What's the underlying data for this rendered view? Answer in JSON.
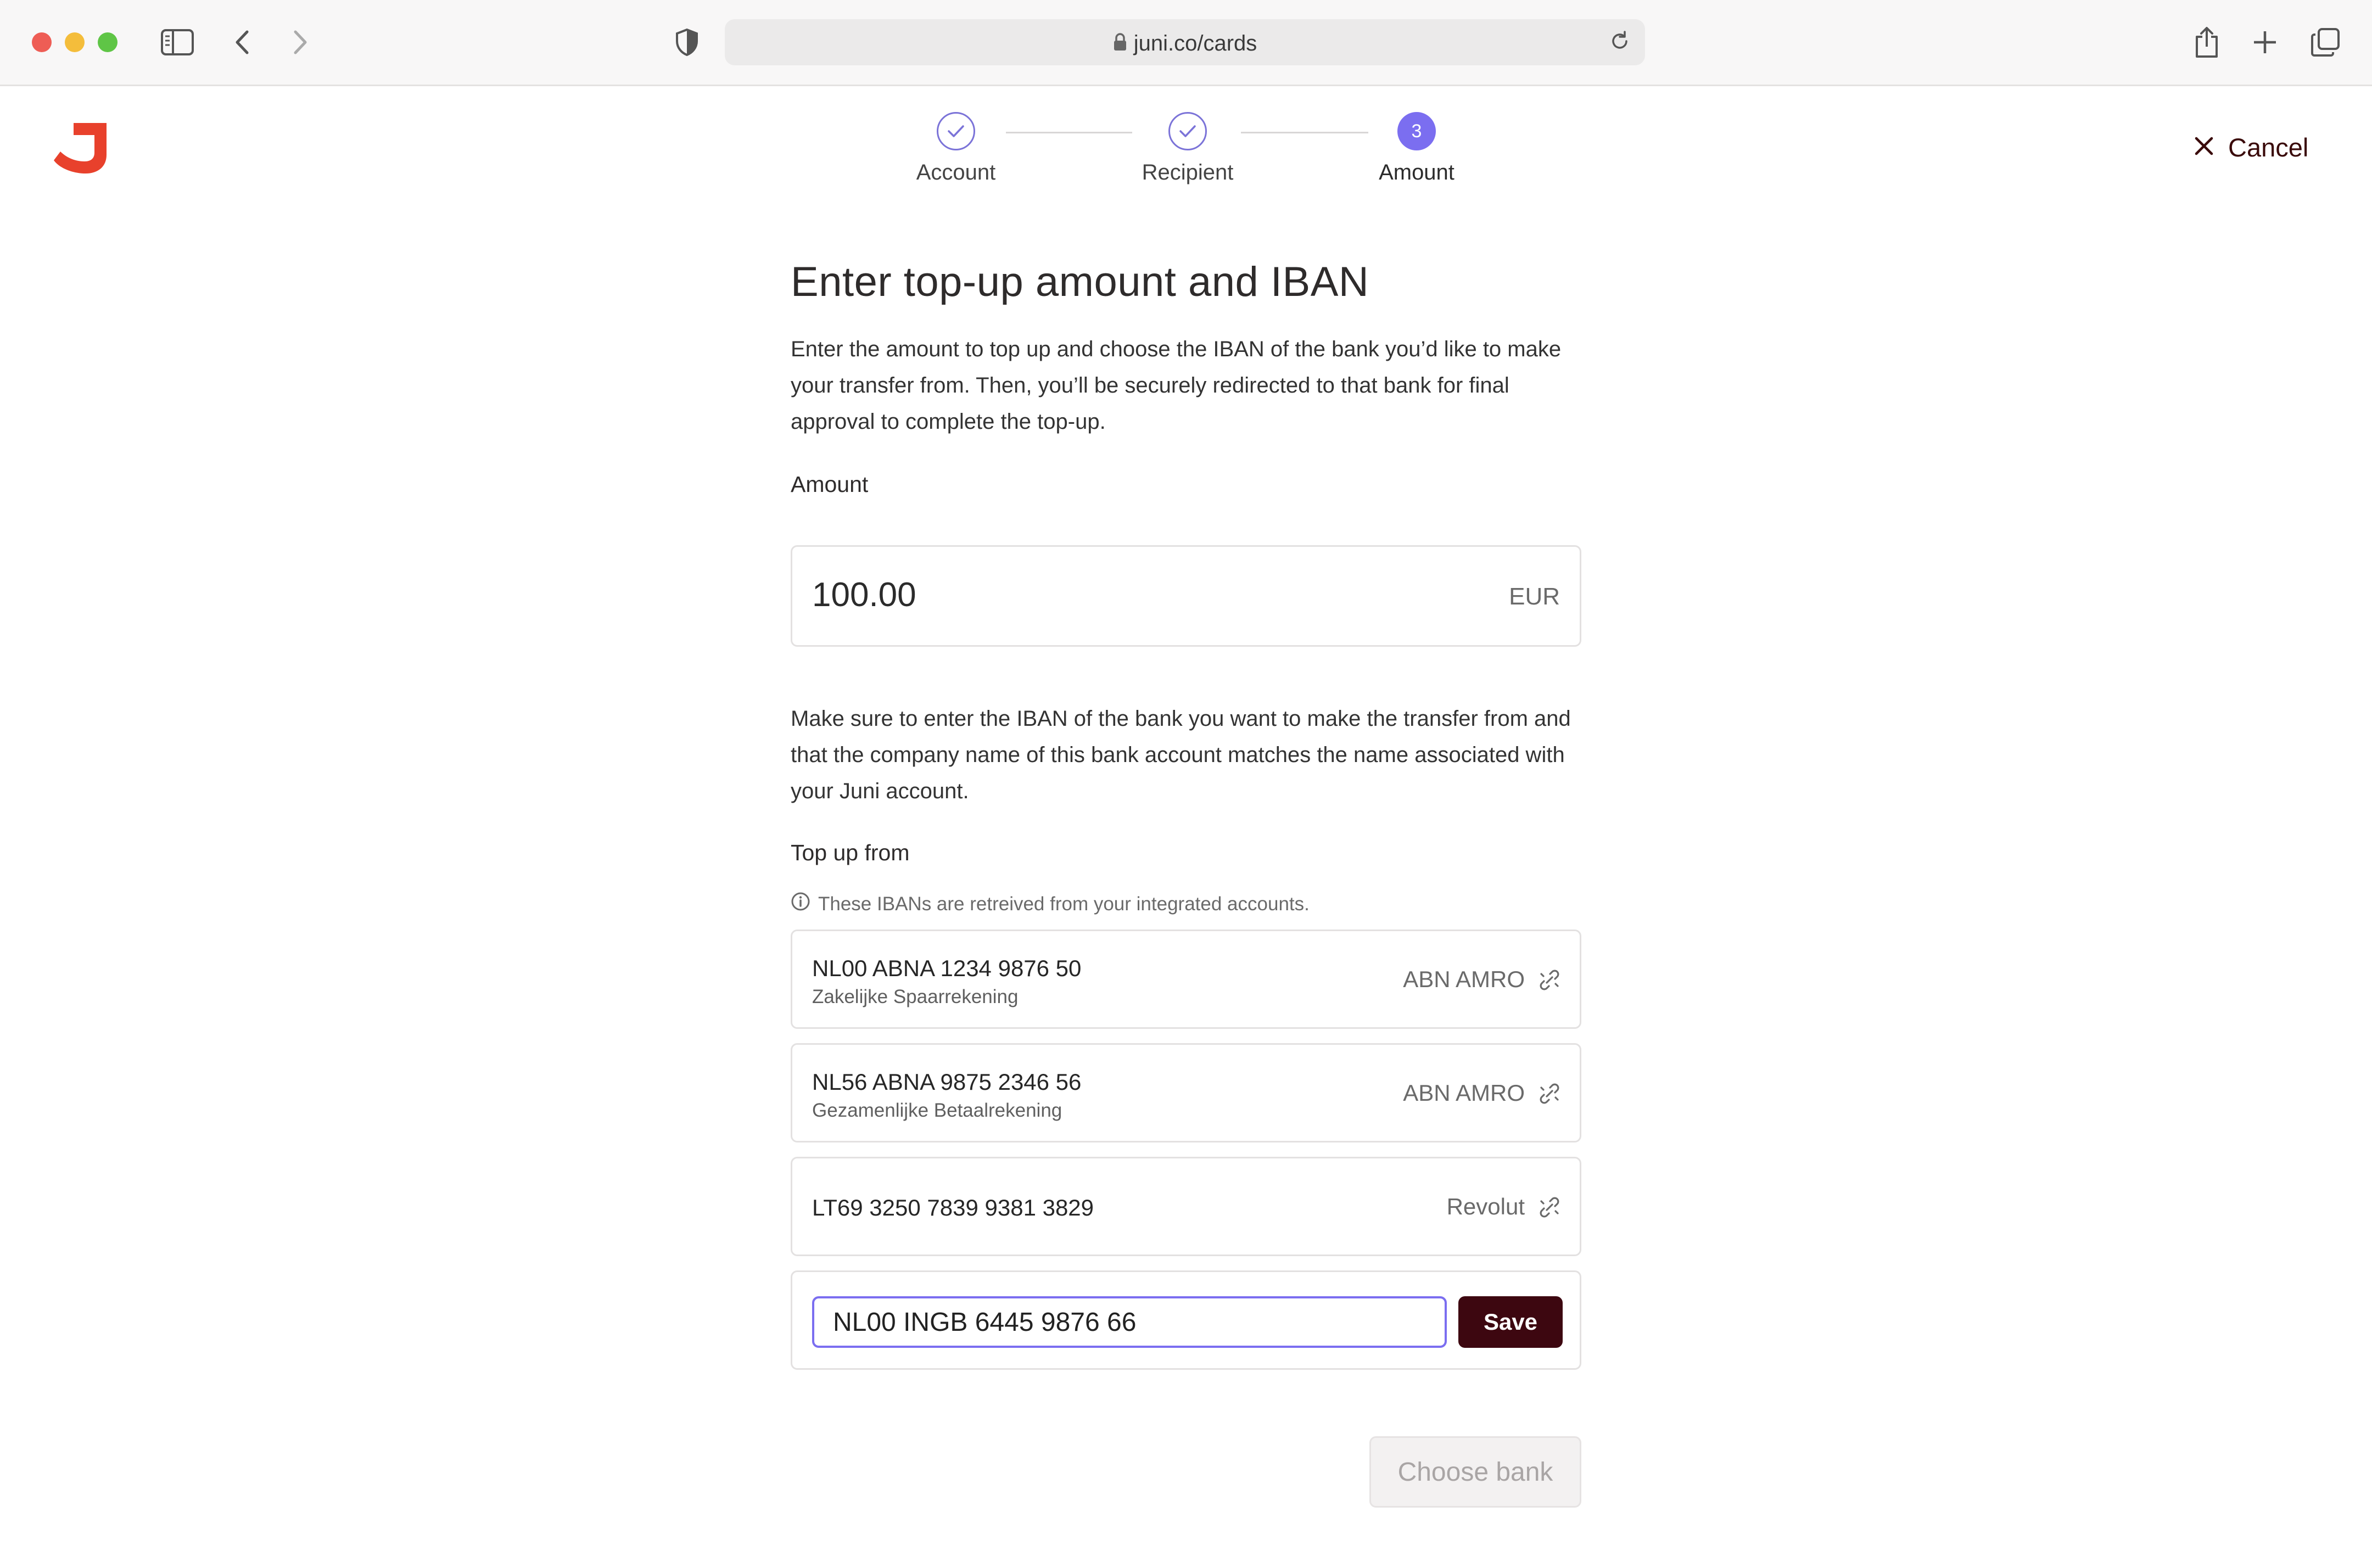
{
  "browser": {
    "url": "juni.co/cards"
  },
  "header": {
    "cancel_label": "Cancel"
  },
  "stepper": {
    "steps": [
      {
        "label": "Account",
        "state": "done"
      },
      {
        "label": "Recipient",
        "state": "done"
      },
      {
        "label": "Amount",
        "state": "active",
        "number": "3"
      }
    ]
  },
  "main": {
    "title": "Enter top-up amount and IBAN",
    "intro": "Enter the amount to top up and choose the IBAN of the bank you’d like to make your transfer from. Then, you’ll be securely redirected to that bank for final approval to complete the top-up.",
    "amount_label": "Amount",
    "amount_value": "100.00",
    "currency": "EUR",
    "notice": "Make sure to enter the IBAN of the bank you want to make the transfer from and that the company name of this bank account matches the name associated with your Juni account.",
    "topup_label": "Top up from",
    "hint": "These IBANs are retreived from your integrated accounts.",
    "accounts": [
      {
        "iban": "NL00 ABNA 1234 9876 50",
        "name": "Zakelijke Spaarrekening",
        "bank": "ABN AMRO"
      },
      {
        "iban": "NL56 ABNA 9875 2346 56",
        "name": "Gezamenlijke Betaalrekening",
        "bank": "ABN AMRO"
      },
      {
        "iban": "LT69 3250 7839 9381 3829",
        "name": "",
        "bank": "Revolut"
      }
    ],
    "new_iban_value": "NL00 INGB 6445 9876 66",
    "save_label": "Save",
    "choose_bank_label": "Choose bank"
  },
  "colors": {
    "brand_red": "#e8412c",
    "accent_purple": "#7b6ef0",
    "save_button": "#3d0710"
  }
}
